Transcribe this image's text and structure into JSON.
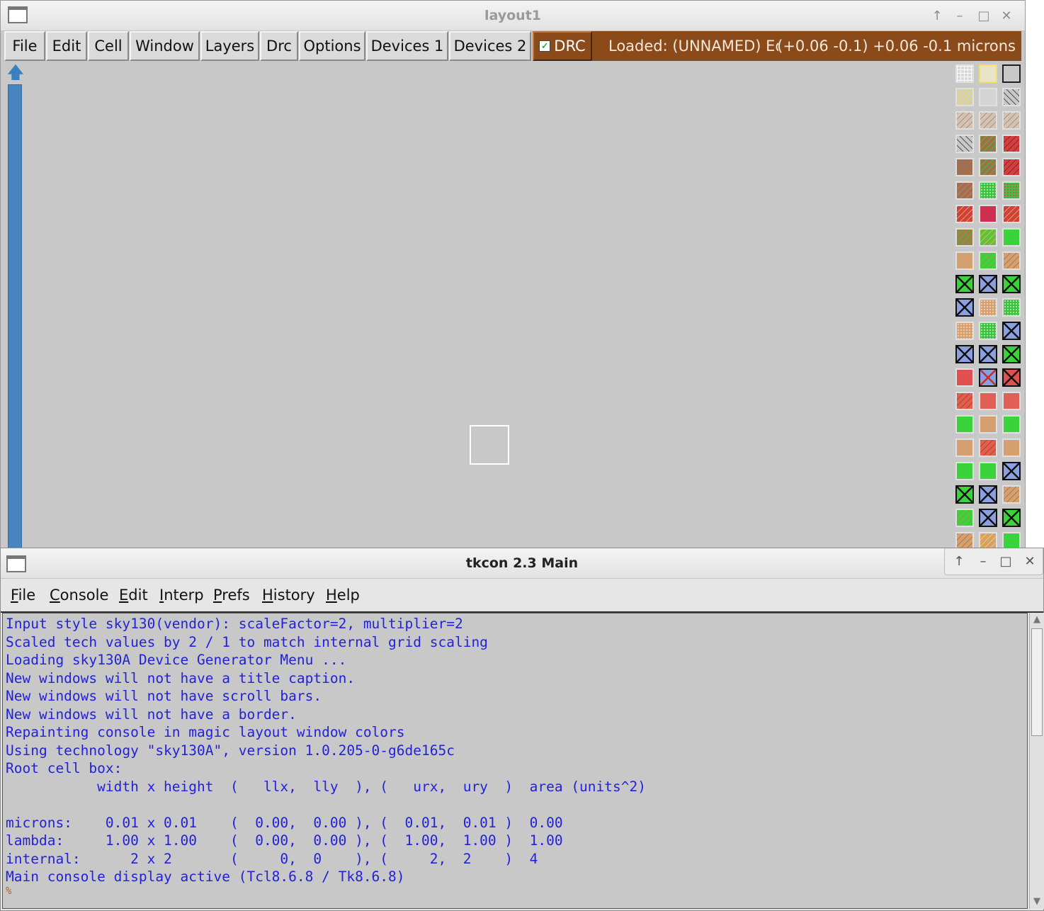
{
  "layout_window": {
    "title": "layout1",
    "menu": [
      "File",
      "Edit",
      "Cell",
      "Window",
      "Layers",
      "Drc",
      "Options",
      "Devices 1",
      "Devices 2"
    ],
    "drc_toggle": {
      "label": "DRC",
      "checked": true
    },
    "status": {
      "loaded": "Loaded: (UNNAMED) Edit",
      "coords": "(+0.06 -0.1) +0.06 -0.1 microns"
    },
    "colors": {
      "status_bg": "#8a4a1a",
      "scrollbar": "#4885be",
      "canvas": "#c8c8c8"
    },
    "palette": {
      "layers": [
        [
          "grid",
          "pale-yellow",
          "outline"
        ],
        [
          "hatch-yellow",
          "plain-grey",
          "hatch-black"
        ],
        [
          "hatch-tan",
          "hatch-tan",
          "hatch-tan"
        ],
        [
          "hatch-black-rev",
          "hatch-green-brown",
          "hatch-red"
        ],
        [
          "solid-brown",
          "hatch-green-brown",
          "hatch-red"
        ],
        [
          "hatch-brown",
          "dots-green",
          "dots-green-red"
        ],
        [
          "hatch-red-orange",
          "solid-magenta-red",
          "hatch-red-orange"
        ],
        [
          "hatch-olive",
          "hatch-lime",
          "solid-green"
        ],
        [
          "solid-tan",
          "hatch-green",
          "hatch-tan-dense"
        ],
        [
          "contact-green",
          "contact-blue",
          "contact-green"
        ],
        [
          "contact-blue",
          "dots-tan",
          "dots-green"
        ],
        [
          "dots-tan",
          "dots-green",
          "contact-blue"
        ],
        [
          "contact-blue",
          "contact-blue",
          "contact-green"
        ],
        [
          "solid-red",
          "contact-blue-red",
          "contact-red"
        ],
        [
          "hatch-salmon",
          "solid-salmon",
          "solid-salmon"
        ],
        [
          "solid-green",
          "solid-tan",
          "solid-green"
        ],
        [
          "solid-tan",
          "hatch-salmon",
          "solid-tan"
        ],
        [
          "solid-green",
          "solid-green",
          "contact-blue"
        ],
        [
          "contact-green",
          "contact-blue",
          "hatch-tan-dense"
        ],
        [
          "hatch-green",
          "contact-blue",
          "contact-green"
        ],
        [
          "hatch-tan-dense",
          "hatch-yellow-tan",
          "solid-green"
        ]
      ]
    }
  },
  "tkcon_window": {
    "title": "tkcon 2.3 Main",
    "menu": [
      {
        "underline": "F",
        "rest": "ile"
      },
      {
        "underline": "C",
        "rest": "onsole"
      },
      {
        "underline": "E",
        "rest": "dit"
      },
      {
        "underline": "I",
        "rest": "nterp"
      },
      {
        "underline": "P",
        "rest": "refs"
      },
      {
        "underline": "H",
        "rest": "istory"
      },
      {
        "underline": "H",
        "rest": "elp"
      }
    ],
    "console_lines": [
      "Input style sky130(vendor): scaleFactor=2, multiplier=2",
      "Scaled tech values by 2 / 1 to match internal grid scaling",
      "Loading sky130A Device Generator Menu ...",
      "New windows will not have a title caption.",
      "New windows will not have scroll bars.",
      "New windows will not have a border.",
      "Repainting console in magic layout window colors",
      "Using technology \"sky130A\", version 1.0.205-0-g6de165c",
      "Root cell box:",
      "           width x height  (   llx,  lly  ), (   urx,  ury  )  area (units^2)",
      "",
      "microns:    0.01 x 0.01    (  0.00,  0.00 ), (  0.01,  0.01 )  0.00",
      "lambda:     1.00 x 1.00    (  0.00,  0.00 ), (  1.00,  1.00 )  1.00",
      "internal:      2 x 2       (     0,  0    ), (     2,  2    )  4",
      "Main console display active (Tcl8.6.8 / Tk8.6.8)"
    ],
    "prompt": "%",
    "colors": {
      "console_text": "#2222d8",
      "console_bg": "#c8c8c8"
    }
  }
}
